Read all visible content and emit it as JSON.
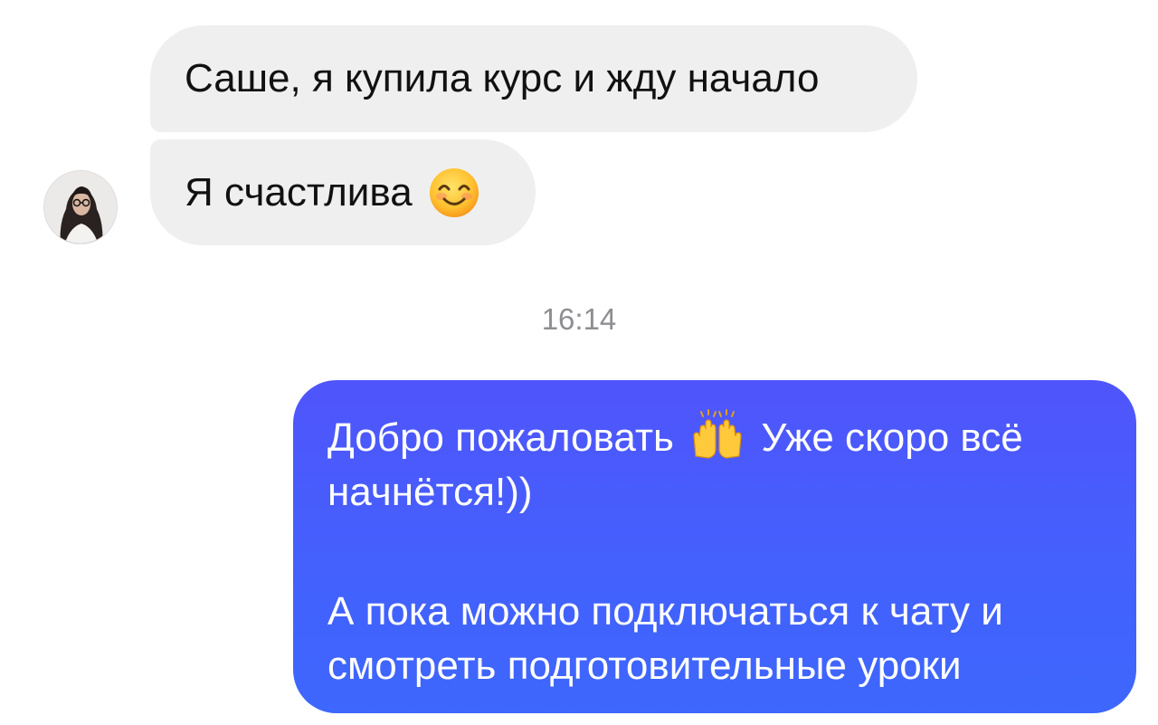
{
  "messages": {
    "incoming_1": "Саше, я купила курс и жду начало",
    "incoming_2": "Я счастлива",
    "timestamp": "16:14",
    "outgoing_line1_part1": "Добро пожаловать",
    "outgoing_line1_part2": "Уже скоро всё",
    "outgoing_line2": "начнётся!))",
    "outgoing_line3": "А пока можно подключаться к чату и",
    "outgoing_line4": "смотреть подготовительные уроки"
  },
  "icons": {
    "avatar": "user-avatar-photo",
    "emoji_1": "smiling-face-emoji",
    "emoji_2": "raising-hands-emoji"
  },
  "colors": {
    "incoming_bubble": "#efefef",
    "outgoing_bubble_top": "#4f55fb",
    "outgoing_bubble_bottom": "#3d67fd",
    "timestamp_text": "#8e8e93"
  }
}
